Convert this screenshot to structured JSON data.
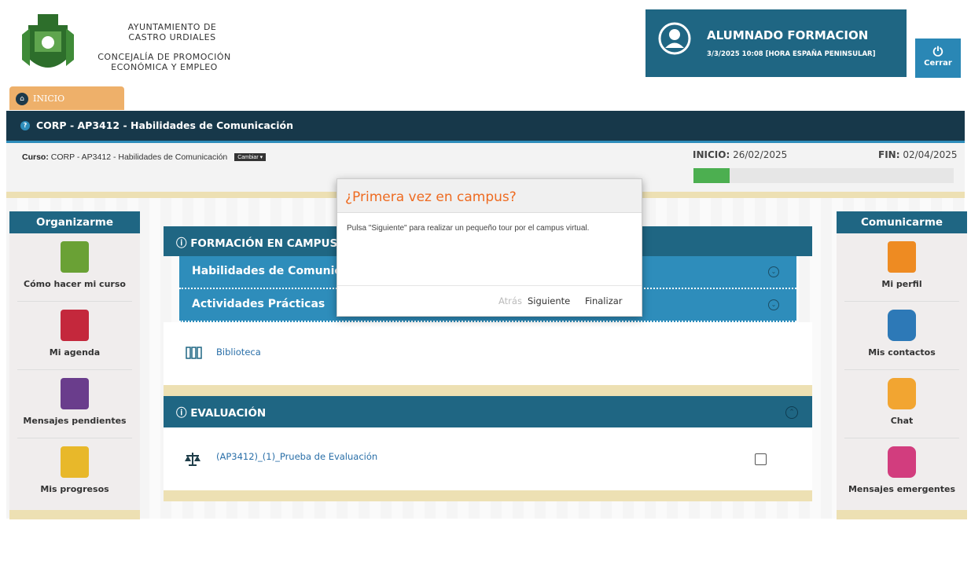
{
  "header": {
    "org_line1": "AYUNTAMIENTO DE",
    "org_line2": "CASTRO URDIALES",
    "org_line3": "CONCEJALÍA DE PROMOCIÓN",
    "org_line4": "ECONÓMICA Y EMPLEO",
    "user_name": "ALUMNADO FORMACION",
    "user_datetime": "3/3/2025 10:08 [HORA ESPAÑA PENINSULAR]",
    "logout_label": "Cerrar"
  },
  "tabs": [
    {
      "label": "INICIO",
      "icon": "home-icon"
    }
  ],
  "title_bar": {
    "title": "CORP - AP3412 - Habilidades de Comunicación"
  },
  "course": {
    "label": "Curso:",
    "name": "CORP - AP3412 - Habilidades de Comunicación",
    "change_label": "Cambiar",
    "start_label": "INICIO:",
    "start_date": "26/02/2025",
    "end_label": "FIN:",
    "end_date": "02/04/2025",
    "progress_percent": 14
  },
  "left_panel": {
    "title": "Organizarme",
    "items": [
      {
        "label": "Cómo hacer mi curso",
        "icon": "info-clipboard-icon",
        "color": "#6aa135"
      },
      {
        "label": "Mi agenda",
        "icon": "calendar-clipboard-icon",
        "color": "#c4283c"
      },
      {
        "label": "Mensajes pendientes",
        "icon": "document-clipboard-icon",
        "color": "#6a3d8c"
      },
      {
        "label": "Mis progresos",
        "icon": "pencil-clipboard-icon",
        "color": "#e8b82a"
      }
    ]
  },
  "right_panel": {
    "title": "Comunicarme",
    "items": [
      {
        "label": "Mi perfil",
        "icon": "profile-card-icon",
        "color": "#ee8b22"
      },
      {
        "label": "Mis contactos",
        "icon": "contacts-icon",
        "color": "#2d79b7"
      },
      {
        "label": "Chat",
        "icon": "chat-icon",
        "color": "#f2a531"
      },
      {
        "label": "Mensajes emergentes",
        "icon": "popup-messages-icon",
        "color": "#d23d7e"
      }
    ]
  },
  "main": {
    "section1": {
      "title": "FORMACIÓN EN CAMPUS",
      "subsections": [
        "Habilidades de Comunicación",
        "Actividades Prácticas"
      ],
      "item": {
        "label": "Biblioteca",
        "icon": "library-books-icon"
      }
    },
    "section2": {
      "title": "EVALUACIÓN",
      "item": {
        "label": "(AP3412)_(1)_Prueba de Evaluación",
        "icon": "scale-icon"
      }
    }
  },
  "modal": {
    "title": "¿Primera vez en campus?",
    "body": "Pulsa \"Siguiente\" para realizar un pequeño tour por el campus virtual.",
    "back_label": "Atrás",
    "next_label": "Siguiente",
    "finish_label": "Finalizar"
  },
  "colors": {
    "accent": "#1f6683",
    "highlight": "#2e8dbb",
    "title_bar": "#17384a",
    "tab": "#eeb06a",
    "modal_title": "#ee6b21",
    "progress": "#4caf50"
  }
}
